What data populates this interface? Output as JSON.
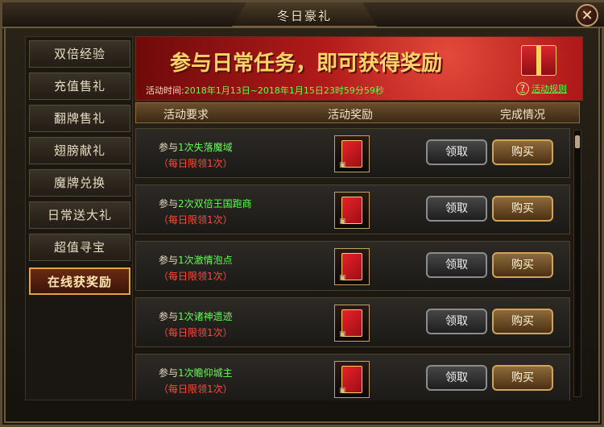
{
  "window": {
    "title": "冬日豪礼",
    "close_glyph": "✕"
  },
  "sidebar": {
    "items": [
      {
        "label": "双倍经验",
        "active": false
      },
      {
        "label": "充值售礼",
        "active": false
      },
      {
        "label": "翻牌售礼",
        "active": false
      },
      {
        "label": "翅膀献礼",
        "active": false
      },
      {
        "label": "魔牌兑换",
        "active": false
      },
      {
        "label": "日常送大礼",
        "active": false
      },
      {
        "label": "超值寻宝",
        "active": false
      },
      {
        "label": "在线获奖励",
        "active": true
      }
    ]
  },
  "banner": {
    "headline": "参与日常任务，即可获得奖励",
    "time_label": "活动时间:",
    "time_value": "2018年1月13日~2018年1月15日23时59分59秒",
    "rules_link": "活动规则",
    "help_glyph": "?"
  },
  "table": {
    "headers": {
      "requirement": "活动要求",
      "reward": "活动奖励",
      "status": "完成情况"
    },
    "rows": [
      {
        "prefix": "参与",
        "task": "1次失落魔域",
        "limit": "（每日限领1次）"
      },
      {
        "prefix": "参与",
        "task": "2次双倍王国跑商",
        "limit": "（每日限领1次）"
      },
      {
        "prefix": "参与",
        "task": "1次激情泡点",
        "limit": "（每日限领1次）"
      },
      {
        "prefix": "参与",
        "task": "1次诸神遗迹",
        "limit": "（每日限领1次）"
      },
      {
        "prefix": "参与",
        "task": "1次瞻仰城主",
        "limit": "（每日限领1次）"
      }
    ],
    "claim_label": "领取",
    "buy_label": "购买"
  },
  "colors": {
    "accent_green": "#5eff4e",
    "limit_red": "#ff4a3a",
    "banner_red": "#b11a1a",
    "gold": "#d2a45a"
  }
}
